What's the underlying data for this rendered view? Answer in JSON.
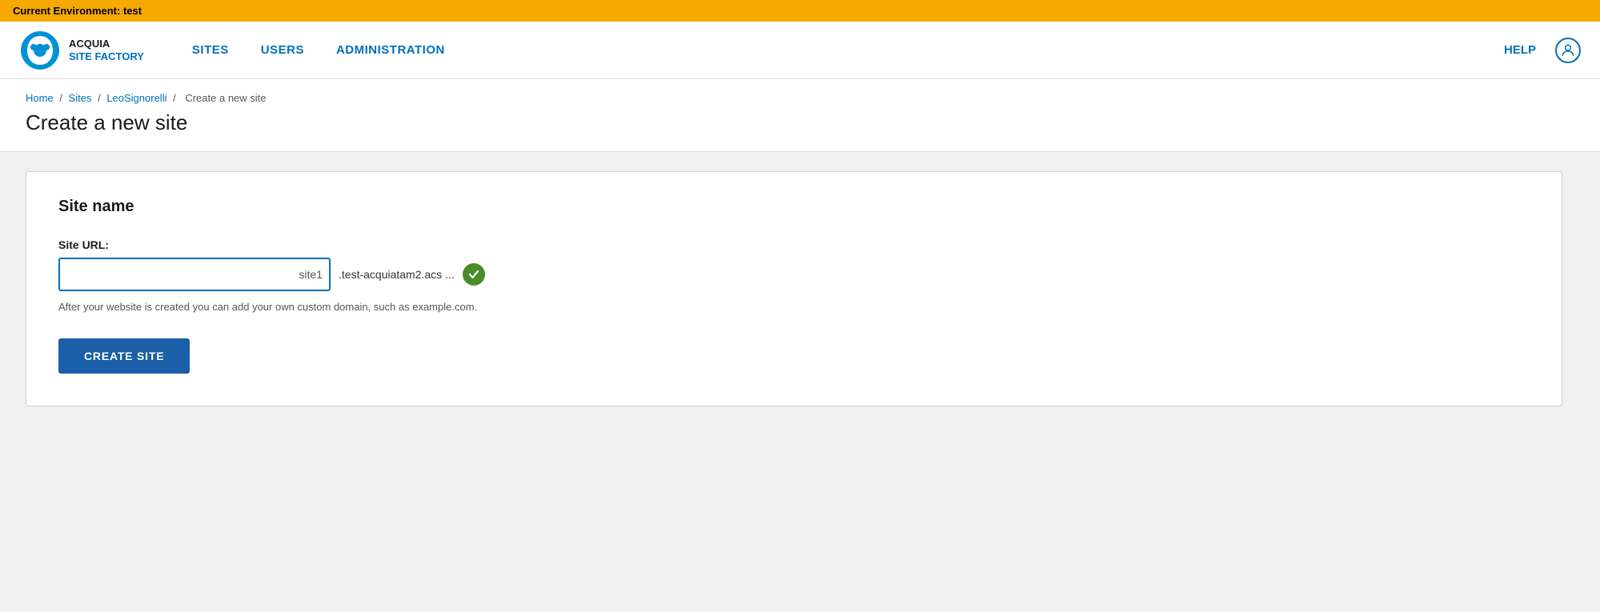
{
  "env_bar": {
    "label": "Current Environment: test"
  },
  "nav": {
    "logo_line1": "ACQUIA",
    "logo_line2": "SITE FACTORY",
    "links": [
      {
        "id": "sites",
        "label": "SITES"
      },
      {
        "id": "users",
        "label": "USERS"
      },
      {
        "id": "administration",
        "label": "ADMINISTRATION"
      }
    ],
    "help_label": "HELP"
  },
  "breadcrumb": {
    "items": [
      {
        "id": "home",
        "label": "Home"
      },
      {
        "id": "sites",
        "label": "Sites"
      },
      {
        "id": "leosignorelli",
        "label": "LeoSignorelli"
      },
      {
        "id": "current",
        "label": "Create a new site"
      }
    ],
    "separator": "/"
  },
  "page_title": "Create a new site",
  "form": {
    "section_title": "Site name",
    "site_url_label": "Site URL:",
    "site_url_placeholder": "",
    "site_url_suffix": "site1",
    "domain_suffix": ".test-acquiatam2.acs ...",
    "helper_text": "After your website is created you can add your own custom domain, such as example.com.",
    "create_button_label": "CREATE SITE"
  }
}
